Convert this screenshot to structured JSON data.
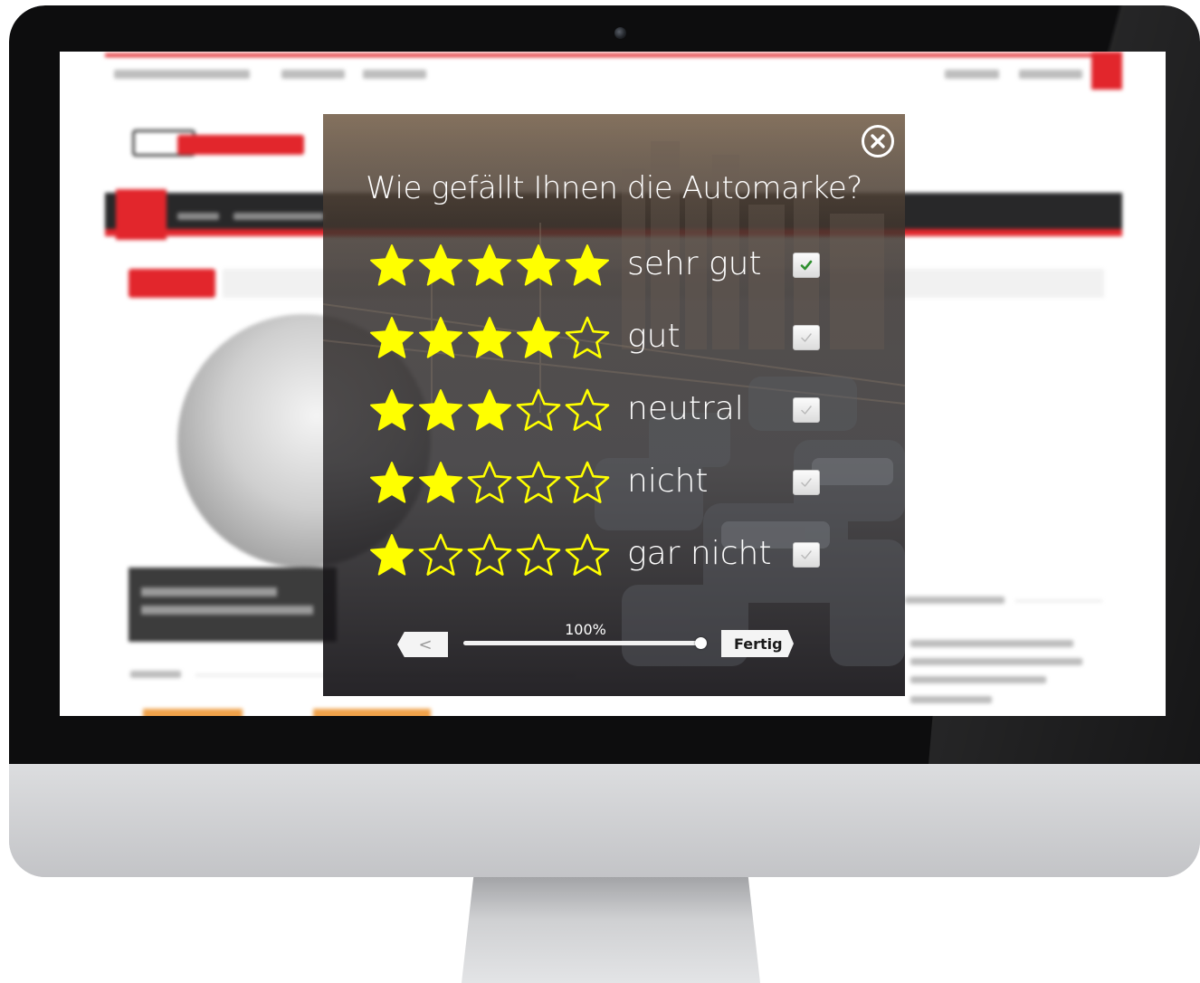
{
  "popup": {
    "question": "Wie gefällt Ihnen die Automarke?",
    "close_icon": "close-circle-icon",
    "star_color": "#ffff00",
    "ratings": [
      {
        "label": "sehr gut",
        "stars": 5,
        "checked": true
      },
      {
        "label": "gut",
        "stars": 4,
        "checked": false
      },
      {
        "label": "neutral",
        "stars": 3,
        "checked": false
      },
      {
        "label": "nicht",
        "stars": 2,
        "checked": false
      },
      {
        "label": "gar nicht",
        "stars": 1,
        "checked": false
      }
    ],
    "max_stars": 5,
    "back_label": "<",
    "progress_label": "100%",
    "progress_value": 1.0,
    "done_label": "Fertig"
  },
  "colors": {
    "accent_red": "#e2262c",
    "check_green": "#2f8f2f"
  }
}
